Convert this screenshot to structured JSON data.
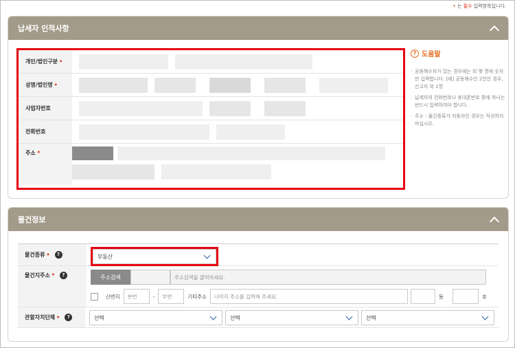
{
  "notice": {
    "dot": "•",
    "prefix": "는 ",
    "required_word": "필수",
    "suffix": " 입력항목입니다."
  },
  "taxpayer": {
    "title": "납세자 인적사항",
    "rows": [
      {
        "label": "개인/법인구분",
        "required": true
      },
      {
        "label": "성명/법인명",
        "required": true
      },
      {
        "label": "사업자번호",
        "required": false
      },
      {
        "label": "전화번호",
        "required": false
      },
      {
        "label": "주소",
        "required": true
      }
    ],
    "req_mark": "•"
  },
  "help": {
    "title": "도움말",
    "icon_char": "?",
    "items": [
      "공동해수자가 있는 경우에는 외 몇 명에 숫자만 입력합니다. [예] 공동해수인 2인인 경우, 신고자 외 1명",
      "납세자의 전화번호나 휴대폰번호 중에 하나는 반드시 입력하여야 합니다.",
      "주소 : 물건종류가 자동차인 경우는 작성하지 마십시오."
    ]
  },
  "property": {
    "title": "물건정보",
    "req_mark": "•",
    "qmark": "?",
    "type_label": "물건종류",
    "type_value": "부동산",
    "addr_label": "물건지주소",
    "addr_search_btn": "주소검색",
    "addr_placeholder": "주소검색을 클릭하세요.",
    "mountain_label": "산번지",
    "main_no_placeholder": "본번",
    "dash": "-",
    "sub_no_placeholder": "부번",
    "etc_label": "기타주소",
    "etc_placeholder": "나머지 주소를 입력해 주세요.",
    "dong_label": "동",
    "ho_label": "호",
    "gov_label": "관할자치단체",
    "gov_selects": [
      "선택",
      "선택",
      "선택"
    ]
  },
  "colors": {
    "header_bg": "#a39a8a",
    "required": "#e0301e",
    "highlight": "#e60012",
    "help_accent": "#e46a1e"
  }
}
